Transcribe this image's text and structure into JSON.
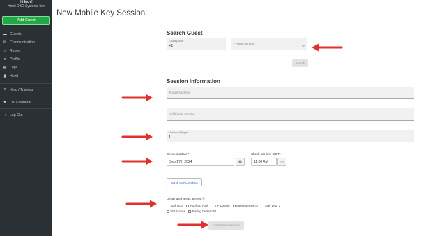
{
  "sidebar": {
    "greeting": "Hi Indy!",
    "hotel_name": "Hotel DBC Systems live",
    "add_guest_label": "Add Guest",
    "items": [
      {
        "label": "Guests",
        "icon": "bed-icon"
      },
      {
        "label": "Communication",
        "icon": "mail-icon"
      },
      {
        "label": "Report",
        "icon": "chart-icon"
      },
      {
        "label": "Profile",
        "icon": "user-icon"
      },
      {
        "label": "Logs",
        "icon": "list-icon"
      },
      {
        "label": "Hotel",
        "icon": "building-icon"
      },
      {
        "label": "Help / Training",
        "icon": "help-icon"
      },
      {
        "label": "DK Collateral",
        "icon": "collateral-icon"
      },
      {
        "label": "Log Out",
        "icon": "logout-icon"
      }
    ]
  },
  "page": {
    "title": "New Mobile Key Session."
  },
  "search_guest": {
    "title": "Search Guest",
    "country_code_label": "Country code",
    "country_code_value": "+1",
    "phone_placeholder": "Phone Number",
    "search_button": "Search"
  },
  "session_info": {
    "title": "Session Information",
    "room_number_placeholder": "Room Number",
    "additional_rooms_placeholder": "Additional Rooms",
    "nights_label": "Number of Nights",
    "nights_value": "1",
    "checkout_date_label": "Check out date *",
    "checkout_date_value": "Sep 17th 2024",
    "checkout_time_label": "Check out time (CDT) *",
    "checkout_time_value": "11:00 AM",
    "same_day_button": "Same Day Checkout",
    "areas_label": "Designated areas access",
    "areas": [
      "Staff Door",
      "RoofTop Pool",
      "VIP Lounge",
      "Meeting Room A",
      "Staff Door 2",
      "VIP Access",
      "Testing Center VIP"
    ],
    "create_button": "Create New Session"
  },
  "colors": {
    "sidebar_bg": "#2b3034",
    "add_guest_green": "#22a845",
    "arrow_red": "#e0322d",
    "link_blue": "#2a6fd0"
  }
}
